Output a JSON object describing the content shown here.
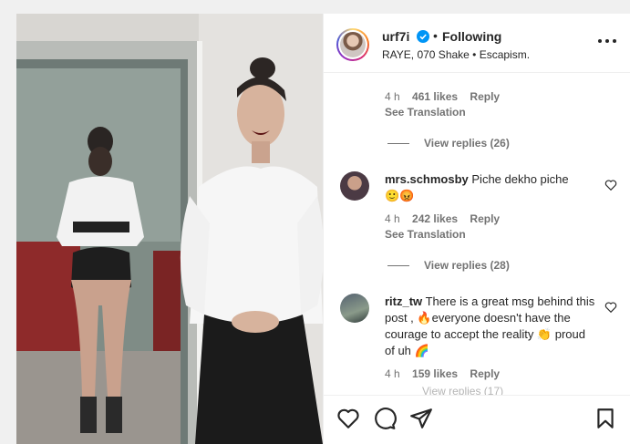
{
  "post": {
    "username": "urf7i",
    "separator": "•",
    "follow_status": "Following",
    "audio": "RAYE, 070 Shake • Escapism."
  },
  "top_comment_tail": {
    "time": "4 h",
    "likes": "461 likes",
    "reply": "Reply",
    "see_translation": "See Translation",
    "view_replies": "View replies (26)"
  },
  "comments": [
    {
      "username": "mrs.schmosby",
      "text": "Piche dekho piche",
      "emojis": "🙂😡",
      "time": "4 h",
      "likes": "242 likes",
      "reply": "Reply",
      "see_translation": "See Translation",
      "view_replies": "View replies (28)"
    },
    {
      "username": "ritz_tw",
      "text": "There is a great msg behind this post , 🔥everyone doesn't have the courage to accept the reality 👏 proud of uh 🌈",
      "time": "4 h",
      "likes": "159 likes",
      "reply": "Reply",
      "view_replies_partial": "View replies (17)"
    }
  ],
  "icons": {
    "like": "heart-icon",
    "comment": "comment-icon",
    "share": "paper-plane-icon",
    "save": "bookmark-icon",
    "more": "more-options-icon",
    "verified": "verified-badge-icon"
  },
  "colors": {
    "verified_blue": "#0095f6",
    "text": "#262626",
    "secondary": "#737373"
  }
}
